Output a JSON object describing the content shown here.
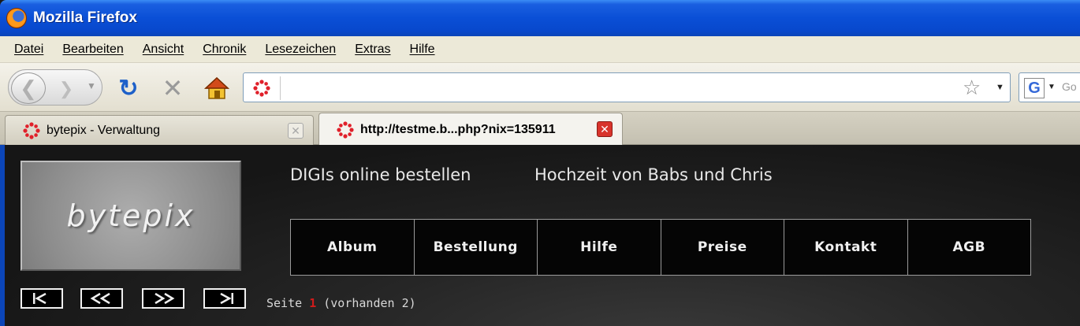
{
  "window": {
    "title": "Mozilla Firefox"
  },
  "menubar": {
    "items": [
      {
        "label": "Datei"
      },
      {
        "label": "Bearbeiten"
      },
      {
        "label": "Ansicht"
      },
      {
        "label": "Chronik"
      },
      {
        "label": "Lesezeichen"
      },
      {
        "label": "Extras"
      },
      {
        "label": "Hilfe"
      }
    ]
  },
  "toolbar": {
    "url": "",
    "search_placeholder": "Go"
  },
  "tabs": [
    {
      "label": "bytepix - Verwaltung",
      "active": false
    },
    {
      "label": "http://testme.b...php?nix=135911",
      "active": true
    }
  ],
  "page": {
    "logo_text": "bytepix",
    "heading_left": "DIGIs online bestellen",
    "heading_right": "Hochzeit von Babs und Chris",
    "nav": [
      "Album",
      "Bestellung",
      "Hilfe",
      "Preise",
      "Kontakt",
      "AGB"
    ],
    "pager": {
      "prefix": "Seite",
      "current": "1",
      "suffix": "(vorhanden 2)"
    }
  },
  "colors": {
    "titlebar": "#0a4fd6",
    "page_bg": "#1a1a1a",
    "current_page": "#d11b1b",
    "favicon": "#e0202a"
  }
}
